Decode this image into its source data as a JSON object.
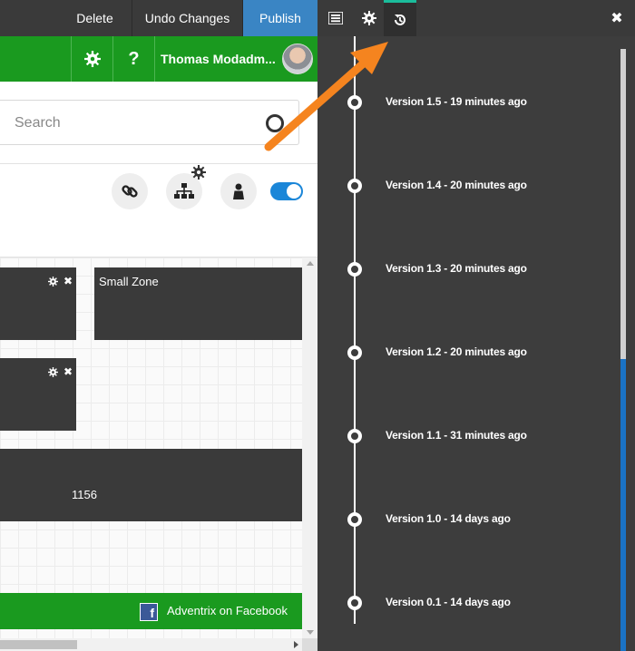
{
  "toolbar": {
    "delete_label": "Delete",
    "undo_label": "Undo Changes",
    "publish_label": "Publish",
    "list_icon": "list-icon",
    "settings_icon": "gear-icon",
    "history_icon": "history-icon",
    "close_icon": "close-icon",
    "publish_color": "#3a85c4",
    "active_tab_accent": "#1bbc9b"
  },
  "site_header": {
    "settings_icon": "gear-icon",
    "help_label": "?",
    "user_name": "Thomas Modadm...",
    "brand_color": "#1a9a1f"
  },
  "search": {
    "placeholder": "Search"
  },
  "page_tools": {
    "link_icon": "link-icon",
    "sitemap_icon": "sitemap-icon",
    "person_icon": "person-icon",
    "toggle_on": true,
    "toggle_color": "#1a86d8"
  },
  "zones": {
    "small_zone_label": "Small Zone",
    "wide_zone_value": "1156"
  },
  "footer": {
    "facebook_label": "Adventrix on Facebook",
    "facebook_icon": "facebook-icon",
    "facebook_glyph": "f"
  },
  "history_panel": {
    "versions": [
      {
        "label": "Version 1.5 - 19 minutes ago"
      },
      {
        "label": "Version 1.4 - 20 minutes ago"
      },
      {
        "label": "Version 1.3 - 20 minutes ago"
      },
      {
        "label": "Version 1.2 - 20 minutes ago"
      },
      {
        "label": "Version 1.1 - 31 minutes ago"
      },
      {
        "label": "Version 1.0 - 14 days ago"
      },
      {
        "label": "Version 0.1 - 14 days ago"
      }
    ]
  },
  "annotation": {
    "arrow_color": "#f5841f"
  }
}
